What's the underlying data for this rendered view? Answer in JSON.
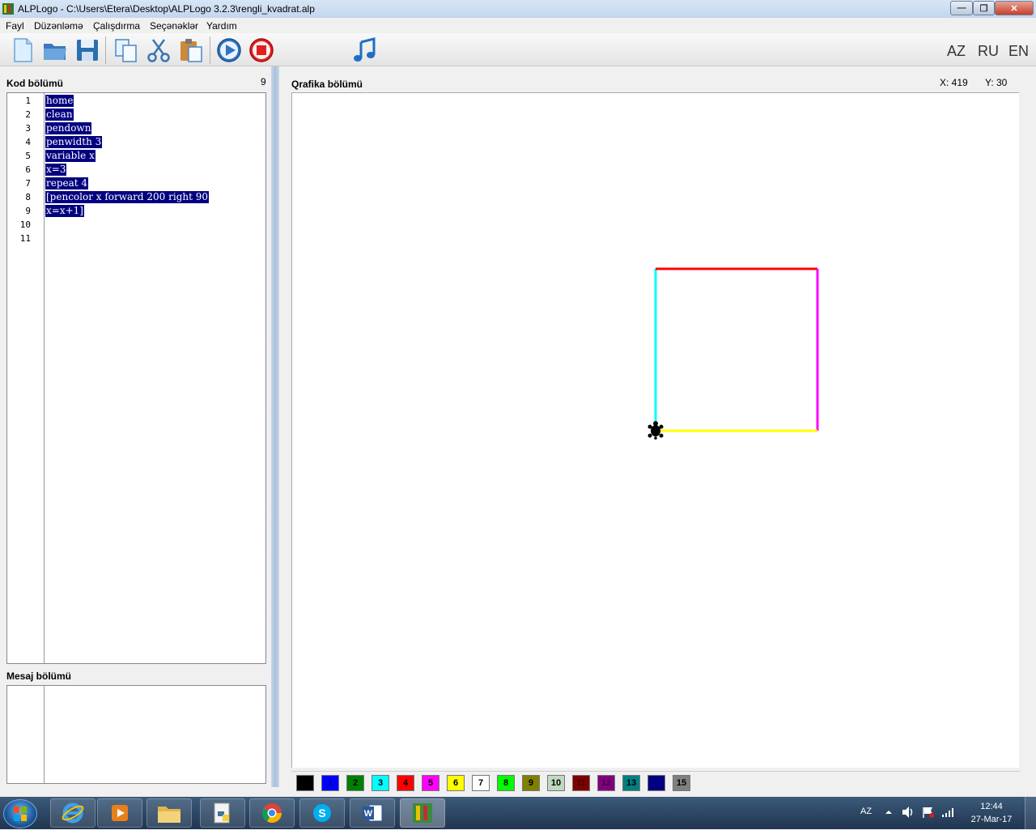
{
  "window": {
    "title": "ALPLogo - C:\\Users\\Etera\\Desktop\\ALPLogo 3.2.3\\rengli_kvadrat.alp",
    "min_glyph": "—",
    "max_glyph": "❐",
    "close_glyph": "✕"
  },
  "menu": {
    "items": [
      "Fayl",
      "Düzənləmə",
      "Çalışdırma",
      "Seçənəklər",
      "Yardım"
    ]
  },
  "toolbar": {
    "buttons": [
      "new-file-icon",
      "open-folder-icon",
      "save-icon",
      "copy-icon",
      "cut-icon",
      "paste-icon",
      "run-icon",
      "stop-icon",
      "music-note-icon"
    ],
    "languages": [
      "AZ",
      "RU",
      "EN"
    ]
  },
  "code_panel": {
    "label": "Kod bölümü",
    "line_count": "9",
    "line_numbers": [
      "1",
      "2",
      "3",
      "4",
      "5",
      "6",
      "7",
      "8",
      "9",
      "10",
      "11"
    ],
    "lines": [
      "home",
      "clean",
      "pendown",
      "penwidth 3",
      "variable x",
      "x=3",
      "repeat 4",
      "[pencolor x forward 200 right 90",
      "x=x+1]"
    ]
  },
  "message_panel": {
    "label": "Mesaj bölümü"
  },
  "graphics_panel": {
    "label": "Qrafika bölümü",
    "coord_x": "X: 419",
    "coord_y": "Y: 30",
    "drawing": {
      "square_side": 200,
      "pen_width": 3,
      "segments": [
        {
          "color_index": 3,
          "color": "#00ffff",
          "direction": "up"
        },
        {
          "color_index": 4,
          "color": "#ff0000",
          "direction": "right"
        },
        {
          "color_index": 5,
          "color": "#ff00ff",
          "direction": "down"
        },
        {
          "color_index": 6,
          "color": "#ffff00",
          "direction": "left"
        }
      ],
      "turtle_icon": "turtle-icon"
    }
  },
  "palette": {
    "swatches": [
      {
        "label": "",
        "color": "#000000",
        "text_color": "#000000"
      },
      {
        "label": "1",
        "color": "#0000ff",
        "text_color": "#000080"
      },
      {
        "label": "2",
        "color": "#008000",
        "text_color": "#000000"
      },
      {
        "label": "3",
        "color": "#00ffff",
        "text_color": "#000000"
      },
      {
        "label": "4",
        "color": "#ff0000",
        "text_color": "#000000"
      },
      {
        "label": "5",
        "color": "#ff00ff",
        "text_color": "#000000"
      },
      {
        "label": "6",
        "color": "#ffff00",
        "text_color": "#000000"
      },
      {
        "label": "7",
        "color": "#ffffff",
        "text_color": "#000000"
      },
      {
        "label": "8",
        "color": "#00ff00",
        "text_color": "#000000"
      },
      {
        "label": "9",
        "color": "#808000",
        "text_color": "#000000"
      },
      {
        "label": "10",
        "color": "#c0d8c0",
        "text_color": "#000000"
      },
      {
        "label": "11",
        "color": "#800000",
        "text_color": "#400000"
      },
      {
        "label": "12",
        "color": "#800080",
        "text_color": "#400040"
      },
      {
        "label": "13",
        "color": "#008080",
        "text_color": "#000000"
      },
      {
        "label": "14",
        "color": "#000080",
        "text_color": "#000080"
      },
      {
        "label": "15",
        "color": "#808080",
        "text_color": "#000000"
      }
    ]
  },
  "taskbar": {
    "apps": [
      "internet-explorer-icon",
      "media-player-icon",
      "file-explorer-icon",
      "python-icon",
      "chrome-icon",
      "skype-icon",
      "word-icon",
      "alplogo-icon"
    ],
    "tray_language": "AZ",
    "time": "12:44",
    "date": "27-Mar-17"
  }
}
